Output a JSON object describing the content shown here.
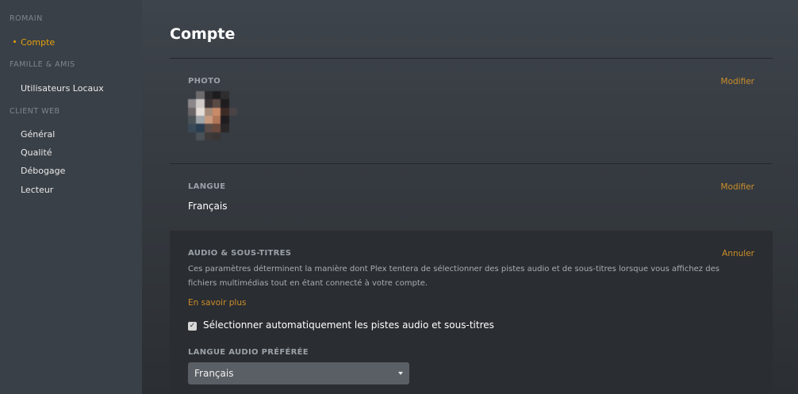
{
  "sidebar": {
    "sections": [
      {
        "title": "ROMAIN",
        "items": [
          {
            "label": "Compte",
            "active": true
          }
        ]
      },
      {
        "title": "FAMILLE & AMIS",
        "items": [
          {
            "label": "Utilisateurs Locaux"
          }
        ]
      },
      {
        "title": "CLIENT WEB",
        "items": [
          {
            "label": "Général"
          },
          {
            "label": "Qualité"
          },
          {
            "label": "Débogage"
          },
          {
            "label": "Lecteur"
          }
        ]
      }
    ]
  },
  "main": {
    "title": "Compte",
    "photo": {
      "label": "PHOTO",
      "action": "Modifier"
    },
    "language": {
      "label": "LANGUE",
      "action": "Modifier",
      "value": "Français"
    },
    "audio": {
      "label": "AUDIO & SOUS-TITRES",
      "action": "Annuler",
      "description": "Ces paramètres déterminent la manière dont Plex tentera de sélectionner des pistes audio et de sous-titres lorsque vous affichez des fichiers multimédias tout en étant connecté à votre compte.",
      "learn_more": "En savoir plus",
      "auto_select_label": "Sélectionner automatiquement les pistes audio et sous-titres",
      "auto_select_checked": true,
      "preferred_audio_label": "LANGUE AUDIO PRÉFÉRÉE",
      "preferred_audio_value": "Français"
    }
  },
  "colors": {
    "accent": "#e5a00d",
    "link": "#cc8e2a",
    "sidebar_bg": "#3a4047"
  }
}
